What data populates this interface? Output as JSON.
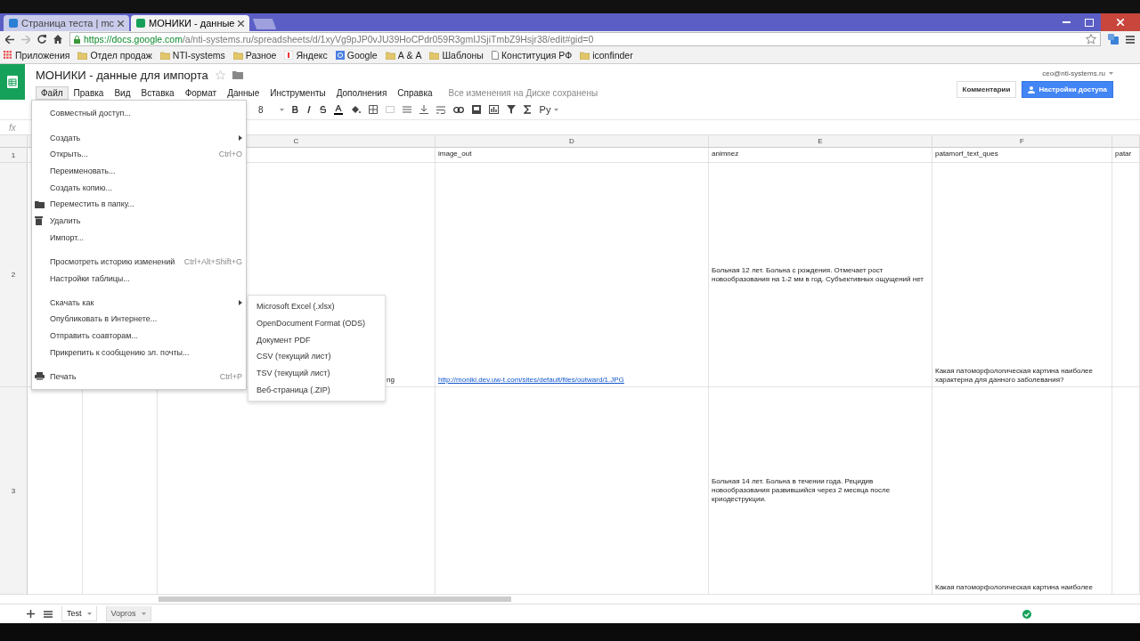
{
  "browser": {
    "tabs": [
      {
        "title": "Страница теста | mc",
        "selected": false
      },
      {
        "title": "МОНИКИ - данные",
        "selected": true
      }
    ],
    "url_host": "https://docs.google.com",
    "url_path": "/a/nti-systems.ru/spreadsheets/d/1xyVg9pJP0vJU39HoCPdr059R3gmIJSjiTmbZ9Hsjr38/edit#gid=0",
    "bookmarks": [
      {
        "kind": "apps",
        "label": "Приложения"
      },
      {
        "kind": "folder",
        "label": "Отдел продаж"
      },
      {
        "kind": "folder",
        "label": "NTI-systems"
      },
      {
        "kind": "folder",
        "label": "Разное"
      },
      {
        "kind": "yandex",
        "label": "Яндекс"
      },
      {
        "kind": "google",
        "label": "Google"
      },
      {
        "kind": "folder",
        "label": "А & А"
      },
      {
        "kind": "folder",
        "label": "Шаблоны"
      },
      {
        "kind": "page",
        "label": "Конституция РФ"
      },
      {
        "kind": "folder",
        "label": "iconfinder"
      }
    ]
  },
  "doc": {
    "title": "МОНИКИ - данные для импорта",
    "account": "ceo@nti-systems.ru",
    "comments_button": "Комментарии",
    "share_button": "Настройки доступа",
    "menus": [
      {
        "label": "Файл",
        "selected": true
      },
      {
        "label": "Правка",
        "selected": false
      },
      {
        "label": "Вид",
        "selected": false
      },
      {
        "label": "Вставка",
        "selected": false
      },
      {
        "label": "Формат",
        "selected": false
      },
      {
        "label": "Данные",
        "selected": false
      },
      {
        "label": "Инструменты",
        "selected": false
      },
      {
        "label": "Дополнения",
        "selected": false
      },
      {
        "label": "Справка",
        "selected": false
      }
    ],
    "save_status": "Все изменения на Диске сохранены"
  },
  "toolbar": {
    "font_size": "8",
    "input_tool": "Ру"
  },
  "formula_bar": {
    "label": "fx"
  },
  "sheet": {
    "columns": [
      "C",
      "D",
      "E",
      "F"
    ],
    "rows": [
      {
        "number": "1",
        "cells": [
          "",
          "image_out",
          "animnez",
          "patamorf_text_ques",
          "patar"
        ]
      },
      {
        "number": "2",
        "cells": [
          "ng",
          "http://moniki.dev.uw-t.com/sites/default/files/outward/1.JPG",
          "Больная 12 лет. Больна с рождения. Отмечает рост новообразования на 1-2 мм в год. Субъективных ощущений нет",
          "Какая патоморфологическая картина наиболее характерна для данного заболевания?",
          ""
        ]
      },
      {
        "number": "3",
        "cells": [
          "",
          "",
          "Больная 14 лет. Больна в течении года. Рецидив новообразования развившийся через 2 месяца после криодеструкции.",
          "Какая патоморфологическая картина наиболее",
          ""
        ]
      }
    ]
  },
  "file_menu": [
    {
      "kind": "item",
      "label": "Совместный доступ..."
    },
    {
      "kind": "separator"
    },
    {
      "kind": "submenu",
      "label": "Создать"
    },
    {
      "kind": "item",
      "label": "Открыть...",
      "shortcut": "Ctrl+O"
    },
    {
      "kind": "item",
      "label": "Переименовать..."
    },
    {
      "kind": "item",
      "label": "Создать копию..."
    },
    {
      "kind": "folder",
      "label": "Переместить в папку..."
    },
    {
      "kind": "trash",
      "label": "Удалить"
    },
    {
      "kind": "item",
      "label": "Импорт..."
    },
    {
      "kind": "separator"
    },
    {
      "kind": "item",
      "label": "Просмотреть историю изменений",
      "shortcut": "Ctrl+Alt+Shift+G"
    },
    {
      "kind": "item",
      "label": "Настройки таблицы..."
    },
    {
      "kind": "separator"
    },
    {
      "kind": "submenu",
      "label": "Скачать как"
    },
    {
      "kind": "item",
      "label": "Опубликовать в Интернете..."
    },
    {
      "kind": "item",
      "label": "Отправить соавторам..."
    },
    {
      "kind": "item",
      "label": "Прикрепить к сообщению эл. почты..."
    },
    {
      "kind": "separator"
    },
    {
      "kind": "printer",
      "label": "Печать",
      "shortcut": "Ctrl+P"
    }
  ],
  "download_submenu": [
    "Microsoft Excel (.xlsx)",
    "OpenDocument Format (ODS)",
    "Документ PDF",
    "CSV (текущий лист)",
    "TSV (текущий лист)",
    "Веб-страница (.ZIP)"
  ],
  "sheet_tabs": [
    {
      "label": "Test",
      "selected": true
    },
    {
      "label": "Vopros",
      "selected": false
    }
  ]
}
